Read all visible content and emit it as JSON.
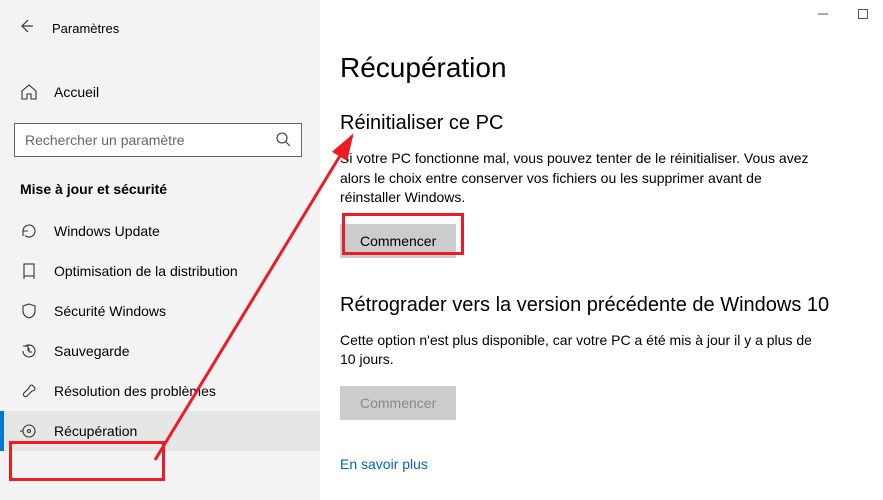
{
  "header": {
    "title": "Paramètres"
  },
  "home": {
    "label": "Accueil"
  },
  "search": {
    "placeholder": "Rechercher un paramètre"
  },
  "section": {
    "heading": "Mise à jour et sécurité"
  },
  "nav": {
    "items": [
      {
        "label": "Windows Update"
      },
      {
        "label": "Optimisation de la distribution"
      },
      {
        "label": "Sécurité Windows"
      },
      {
        "label": "Sauvegarde"
      },
      {
        "label": "Résolution des problèmes"
      },
      {
        "label": "Récupération"
      }
    ]
  },
  "page": {
    "title": "Récupération",
    "reset": {
      "title": "Réinitialiser ce PC",
      "desc": "Si votre PC fonctionne mal, vous pouvez tenter de le réinitialiser. Vous avez alors le choix entre conserver vos fichiers ou les supprimer avant de réinstaller Windows.",
      "button": "Commencer"
    },
    "rollback": {
      "title": "Rétrograder vers la version précédente de Windows 10",
      "desc": "Cette option n'est plus disponible, car votre PC a été mis à jour il y a plus de 10 jours.",
      "button": "Commencer"
    },
    "link": "En savoir plus"
  }
}
